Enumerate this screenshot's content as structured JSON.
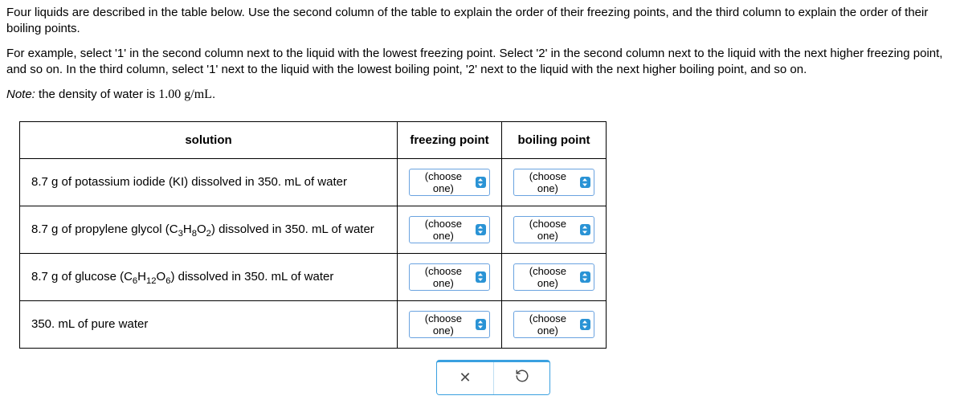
{
  "intro": {
    "p1": "Four liquids are described in the table below. Use the second column of the table to explain the order of their freezing points, and the third column to explain the order of their boiling points.",
    "p2": "For example, select '1' in the second column next to the liquid with the lowest freezing point. Select '2' in the second column next to the liquid with the next higher freezing point, and so on. In the third column, select '1' next to the liquid with the lowest boiling point, '2' next to the liquid with the next higher boiling point, and so on.",
    "note_label": "Note:",
    "note_text": " the density of water is ",
    "density": "1.00 g/mL",
    "period": "."
  },
  "headers": {
    "solution": "solution",
    "freezing": "freezing point",
    "boiling": "boiling point"
  },
  "rows": [
    {
      "pre": "8.7 g of potassium iodide (KI) dissolved in 350. mL of water",
      "formula_html": "",
      "post": ""
    },
    {
      "pre": "8.7 g of propylene glycol (C",
      "formula_html": "3H8O2",
      "post": ") dissolved in 350. mL of water"
    },
    {
      "pre": "8.7 g of glucose (C",
      "formula_html": "6H12O6",
      "post": ") dissolved in 350. mL of water"
    },
    {
      "pre": "350. mL of pure water",
      "formula_html": "",
      "post": ""
    }
  ],
  "chooser_label": "(choose one)",
  "icons": {
    "close": "✕",
    "reset": "↺"
  }
}
